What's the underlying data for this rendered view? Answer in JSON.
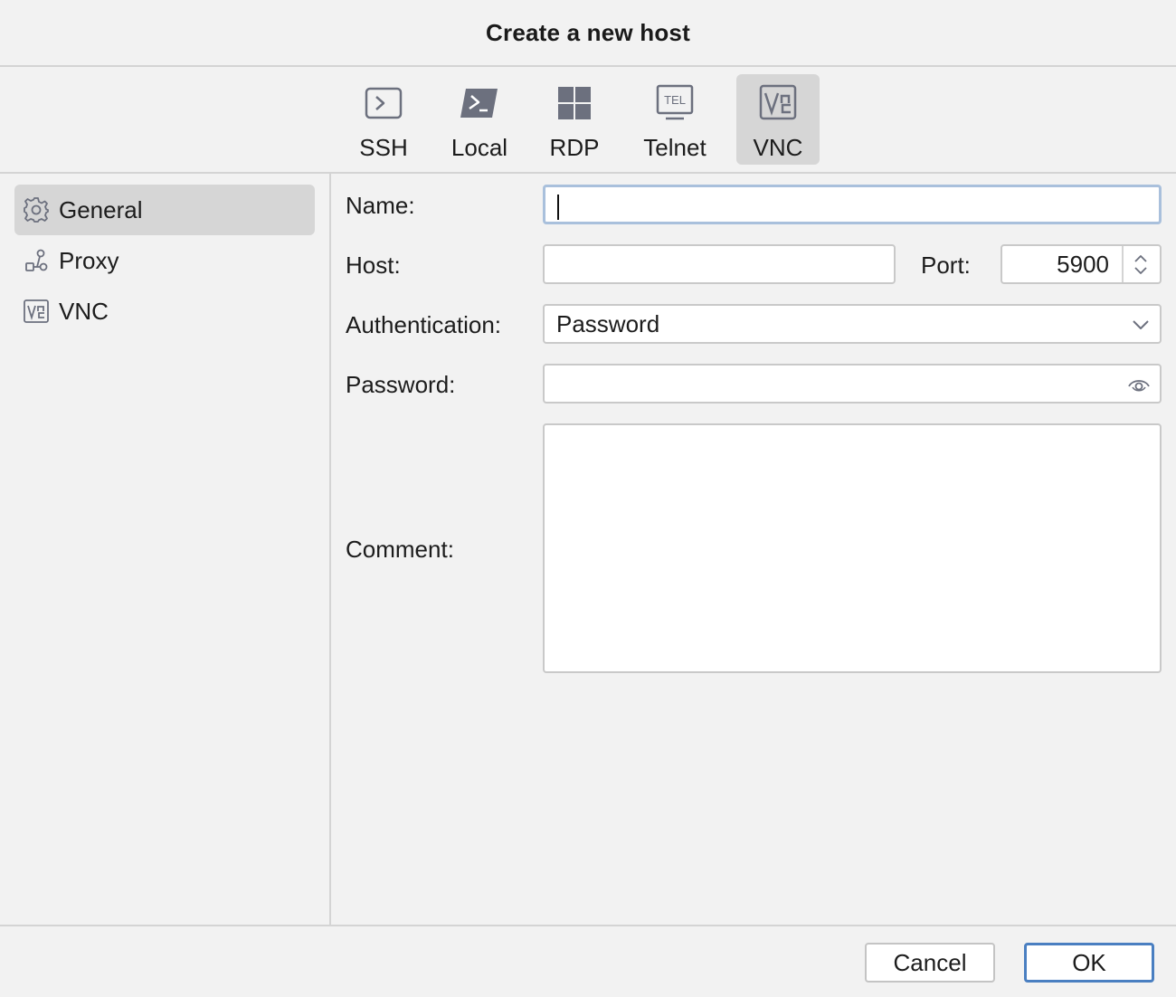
{
  "dialog": {
    "title": "Create a new host"
  },
  "protocols": [
    {
      "id": "ssh",
      "label": "SSH",
      "icon": "terminal-icon"
    },
    {
      "id": "local",
      "label": "Local",
      "icon": "powershell-icon"
    },
    {
      "id": "rdp",
      "label": "RDP",
      "icon": "windows-icon"
    },
    {
      "id": "telnet",
      "label": "Telnet",
      "icon": "telnet-monitor-icon",
      "icon_text": "TEL"
    },
    {
      "id": "vnc",
      "label": "VNC",
      "icon": "vnc-icon",
      "selected": true
    }
  ],
  "sidebar": {
    "items": [
      {
        "label": "General",
        "icon": "gear-icon",
        "selected": true
      },
      {
        "label": "Proxy",
        "icon": "proxy-network-icon"
      },
      {
        "label": "VNC",
        "icon": "vnc-icon"
      }
    ]
  },
  "form": {
    "name": {
      "label": "Name:",
      "value": ""
    },
    "host": {
      "label": "Host:",
      "value": ""
    },
    "port": {
      "label": "Port:",
      "value": "5900"
    },
    "authentication": {
      "label": "Authentication:",
      "value": "Password"
    },
    "password": {
      "label": "Password:",
      "value": ""
    },
    "comment": {
      "label": "Comment:",
      "value": ""
    }
  },
  "footer": {
    "cancel_label": "Cancel",
    "ok_label": "OK"
  },
  "colors": {
    "selected_bg": "#d6d6d6",
    "focus_border": "#a9c0dc",
    "ok_border": "#4a7fc1",
    "icon_gray": "#6c707e"
  }
}
